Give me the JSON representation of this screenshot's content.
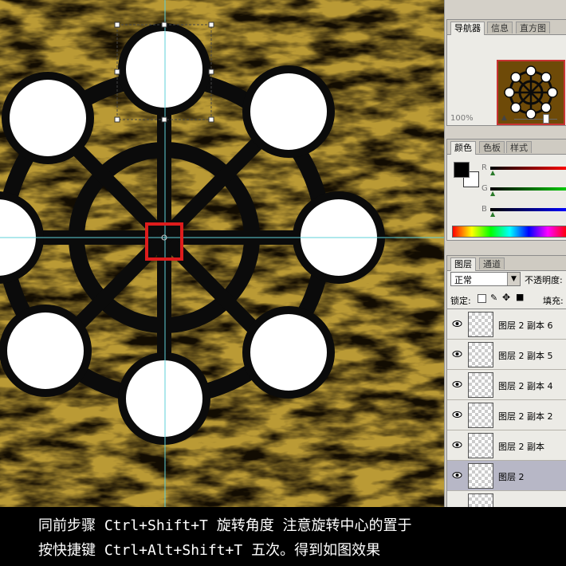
{
  "navigator": {
    "tabs": [
      "导航器",
      "信息",
      "直方图"
    ],
    "zoom": "100%"
  },
  "color_panel": {
    "tabs": [
      "颜色",
      "色板",
      "样式"
    ],
    "channels": [
      "R",
      "G",
      "B"
    ]
  },
  "layers_panel": {
    "tabs": [
      "图层",
      "通道"
    ],
    "blend_mode": "正常",
    "opacity_label": "不透明度:",
    "lock_label": "锁定:",
    "fill_label": "填充:",
    "layers": [
      "图层 2 副本 6",
      "图层 2 副本 5",
      "图层 2 副本 4",
      "图层 2 副本 2",
      "图层 2 副本",
      "图层 2"
    ],
    "selected_index": 5
  },
  "caption": {
    "line1": "同前步骤 Ctrl+Shift+T 旋转角度 注意旋转中心的置于",
    "line2": "按快捷键 Ctrl+Alt+Shift+T 五次。得到如图效果"
  },
  "colors": {
    "background_texture": "#8a5c0a",
    "wheel": "#0b0b0b",
    "guide": "#5fd0d8",
    "highlight": "#dd1c1c"
  }
}
